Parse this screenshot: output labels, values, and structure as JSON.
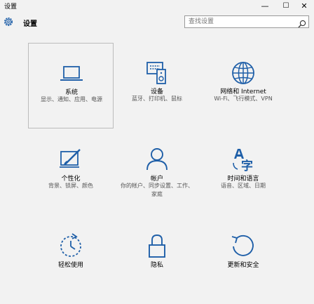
{
  "window": {
    "title": "设置",
    "minimize": "—",
    "maximize": "☐",
    "close": "✕"
  },
  "header": {
    "title": "设置",
    "icon": "gear-icon"
  },
  "search": {
    "placeholder": "查找设置",
    "icon": "search-icon"
  },
  "colors": {
    "accent": "#1f5fa8",
    "background": "#f2f2f2"
  },
  "tiles": [
    {
      "name": "系统",
      "desc": "显示、通知、应用、电源",
      "icon": "laptop-icon"
    },
    {
      "name": "设备",
      "desc": "蓝牙、打印机、鼠标",
      "icon": "devices-icon"
    },
    {
      "name": "网络和 Internet",
      "desc": "Wi-Fi、飞行模式、VPN",
      "icon": "globe-icon"
    },
    {
      "name": "个性化",
      "desc": "背景、锁屏、颜色",
      "icon": "personalize-icon"
    },
    {
      "name": "帐户",
      "desc": "你的帐户、同步设置、工作、家庭",
      "icon": "person-icon"
    },
    {
      "name": "时间和语言",
      "desc": "语音、区域、日期",
      "icon": "time-language-icon"
    },
    {
      "name": "轻松使用",
      "desc": "",
      "icon": "ease-of-access-icon"
    },
    {
      "name": "隐私",
      "desc": "",
      "icon": "lock-icon"
    },
    {
      "name": "更新和安全",
      "desc": "",
      "icon": "update-icon"
    }
  ]
}
